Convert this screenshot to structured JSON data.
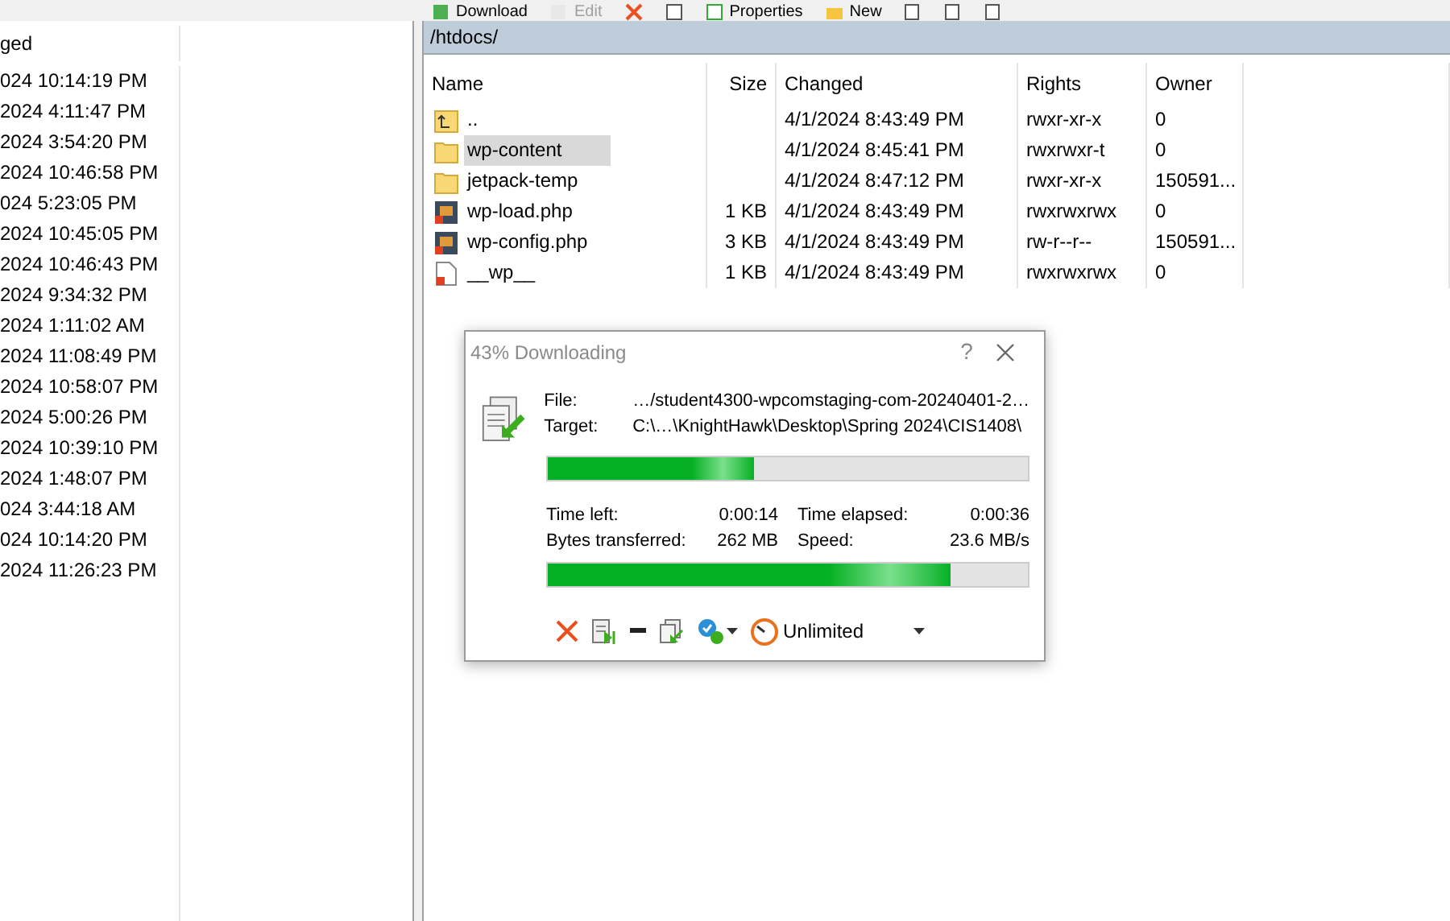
{
  "toolbar": [
    {
      "label": "Download",
      "kind": "download",
      "disabled": false
    },
    {
      "label": "Edit",
      "kind": "edit",
      "disabled": true
    },
    {
      "kind": "delete",
      "disabled": false
    },
    {
      "kind": "rename",
      "disabled": false
    },
    {
      "label": "Properties",
      "kind": "properties",
      "disabled": false
    },
    {
      "label": "New",
      "kind": "new",
      "disabled": false
    },
    {
      "kind": "small",
      "disabled": false
    },
    {
      "kind": "small",
      "disabled": false
    },
    {
      "kind": "small",
      "disabled": false
    }
  ],
  "left_pane": {
    "column_header": "ged",
    "rows": [
      "024 10:14:19 PM",
      "2024 4:11:47 PM",
      "2024 3:54:20 PM",
      "2024 10:46:58 PM",
      "024 5:23:05 PM",
      "2024 10:45:05 PM",
      "2024 10:46:43 PM",
      "2024 9:34:32 PM",
      "2024 1:11:02 AM",
      "2024 11:08:49 PM",
      "2024 10:58:07 PM",
      "2024 5:00:26 PM",
      "2024 10:39:10 PM",
      "2024 1:48:07 PM",
      "024 3:44:18 AM",
      "024 10:14:20 PM",
      "2024 11:26:23 PM"
    ]
  },
  "path": "/htdocs/",
  "table": {
    "columns": [
      "Name",
      "Size",
      "Changed",
      "Rights",
      "Owner"
    ],
    "rows": [
      {
        "kind": "parent",
        "name": "..",
        "size": "",
        "changed": "4/1/2024 8:43:49 PM",
        "rights": "rwxr-xr-x",
        "owner": "0",
        "selected": false
      },
      {
        "kind": "folder",
        "name": "wp-content",
        "size": "",
        "changed": "4/1/2024 8:45:41 PM",
        "rights": "rwxrwxr-t",
        "owner": "0",
        "selected": true
      },
      {
        "kind": "folder",
        "name": "jetpack-temp",
        "size": "",
        "changed": "4/1/2024 8:47:12 PM",
        "rights": "rwxr-xr-x",
        "owner": "150591...",
        "selected": false
      },
      {
        "kind": "php",
        "name": "wp-load.php",
        "size": "1 KB",
        "changed": "4/1/2024 8:43:49 PM",
        "rights": "rwxrwxrwx",
        "owner": "0",
        "selected": false
      },
      {
        "kind": "php",
        "name": "wp-config.php",
        "size": "3 KB",
        "changed": "4/1/2024 8:43:49 PM",
        "rights": "rw-r--r--",
        "owner": "150591...",
        "selected": false
      },
      {
        "kind": "file",
        "name": "__wp__",
        "size": "1 KB",
        "changed": "4/1/2024 8:43:49 PM",
        "rights": "rwxrwxrwx",
        "owner": "0",
        "selected": false
      }
    ]
  },
  "dialog": {
    "title": "43% Downloading",
    "help": "?",
    "file_label": "File:",
    "file": "…/student4300-wpcomstaging-com-20240401-2…",
    "target_label": "Target:",
    "target": "C:\\…\\KnightHawk\\Desktop\\Spring 2024\\CIS1408\\",
    "file_progress": {
      "level": 0.43
    },
    "stats": [
      {
        "label": "Time left:",
        "value": "0:00:14"
      },
      {
        "label": "Time elapsed:",
        "value": "0:00:36"
      },
      {
        "label": "Bytes transferred:",
        "value": "262 MB"
      },
      {
        "label": "Speed:",
        "value": "23.6 MB/s"
      }
    ],
    "total_progress": {
      "level": 0.84
    },
    "speed_limit": "Unlimited"
  }
}
